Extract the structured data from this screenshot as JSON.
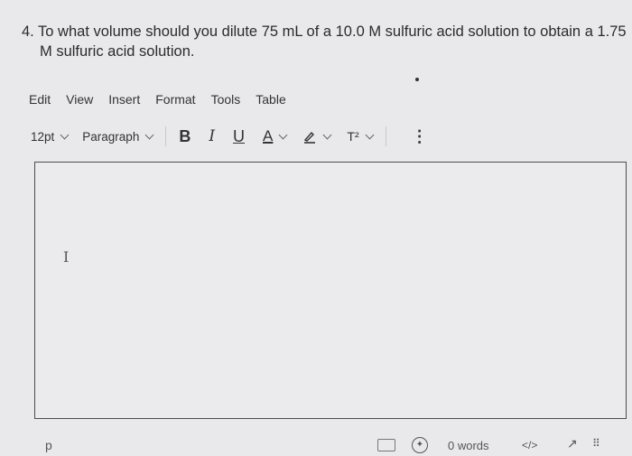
{
  "question": {
    "line1": "4. To what volume should you dilute 75 mL of a 10.0 M sulfuric acid solution to obtain a 1.75",
    "line2": "M sulfuric acid solution."
  },
  "menubar": {
    "items": [
      "Edit",
      "View",
      "Insert",
      "Format",
      "Tools",
      "Table"
    ]
  },
  "toolbar": {
    "font_size": "12pt",
    "block_format": "Paragraph",
    "bold": "B",
    "italic": "I",
    "underline": "U",
    "text_color": "A",
    "superscript": "T²",
    "more": "⋮"
  },
  "statusbar": {
    "path": "p",
    "word_count": "0 words",
    "code": "</>",
    "expand": "↗",
    "grip": "⠿"
  }
}
